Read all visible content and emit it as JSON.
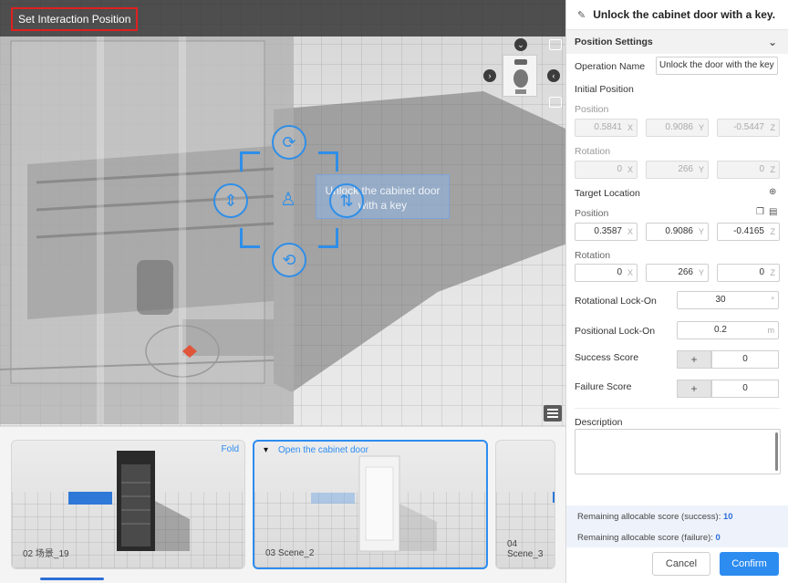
{
  "viewport": {
    "title": "Set Interaction Position",
    "scene_label": "Unlock the cabinet door with a key",
    "icons": {
      "nav_down": "chevron-down-icon",
      "nav_left": "chevron-left-icon",
      "nav_right": "chevron-right-icon",
      "focus": "target-icon",
      "grid": "grid-icon",
      "list": "list-icon"
    },
    "gizmo": {
      "rotate_glyph": "⟳",
      "left_glyph": "⇕",
      "right_glyph": "⇅",
      "bottom_glyph": "⟲",
      "center_glyph": "♙"
    }
  },
  "scene_strip": {
    "fold_label": "Fold",
    "cards": [
      {
        "caption": "02  场景_19"
      },
      {
        "caption": "03  Scene_2",
        "header": "Open the cabinet door"
      },
      {
        "caption": "04  Scene_3"
      }
    ]
  },
  "panel": {
    "header_title": "Unlock the cabinet door with a key.",
    "section_title": "Position Settings",
    "operation_name_label": "Operation Name",
    "operation_name_value": "Unlock the door with the key",
    "initial_position_label": "Initial Position",
    "position_label": "Position",
    "rotation_label": "Rotation",
    "initial": {
      "position": [
        "0.5841",
        "0.9086",
        "-0.5447"
      ],
      "rotation": [
        "0",
        "266",
        "0"
      ]
    },
    "target_location_label": "Target Location",
    "target": {
      "position": [
        "0.3587",
        "0.9086",
        "-0.4165"
      ],
      "rotation": [
        "0",
        "266",
        "0"
      ]
    },
    "axes": [
      "X",
      "Y",
      "Z"
    ],
    "rotational_lock_label": "Rotational Lock-On",
    "rotational_lock_value": "30",
    "rotational_lock_unit": "°",
    "positional_lock_label": "Positional Lock-On",
    "positional_lock_value": "0.2",
    "positional_lock_unit": "m",
    "success_score_label": "Success Score",
    "success_score_value": "0",
    "failure_score_label": "Failure Score",
    "failure_score_value": "0",
    "plus": "+",
    "description_label": "Description",
    "remaining_success_label": "Remaining allocable score (success): ",
    "remaining_success_value": "10",
    "remaining_failure_label": "Remaining allocable score (failure): ",
    "remaining_failure_value": "0",
    "cancel_label": "Cancel",
    "confirm_label": "Confirm"
  },
  "colors": {
    "accent": "#2d8cf0",
    "title_outline": "#e02020",
    "gizmo": "#2f8ee8"
  }
}
